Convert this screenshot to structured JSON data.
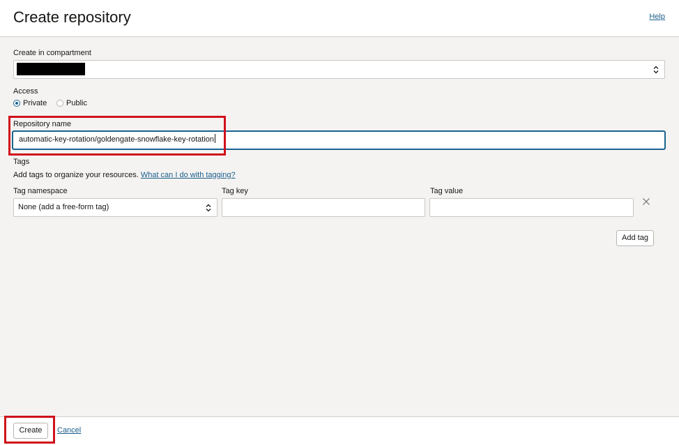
{
  "header": {
    "title": "Create repository",
    "help": "Help"
  },
  "compartment": {
    "label": "Create in compartment",
    "value_redacted": true
  },
  "access": {
    "label": "Access",
    "options": [
      {
        "label": "Private",
        "selected": true
      },
      {
        "label": "Public",
        "selected": false
      }
    ]
  },
  "repository": {
    "label": "Repository name",
    "value": "automatic-key-rotation/goldengate-snowflake-key-rotation"
  },
  "tags": {
    "label": "Tags",
    "description": "Add tags to organize your resources.",
    "help_link": "What can I do with tagging?",
    "namespace_label": "Tag namespace",
    "namespace_value": "None (add a free-form tag)",
    "key_label": "Tag key",
    "key_value": "",
    "value_label": "Tag value",
    "value_value": "",
    "add_tag": "Add tag"
  },
  "footer": {
    "create": "Create",
    "cancel": "Cancel"
  },
  "colors": {
    "accent": "#19638e",
    "link": "#1a5d8a",
    "highlight": "#d0121b",
    "background": "#f4f3f2"
  }
}
